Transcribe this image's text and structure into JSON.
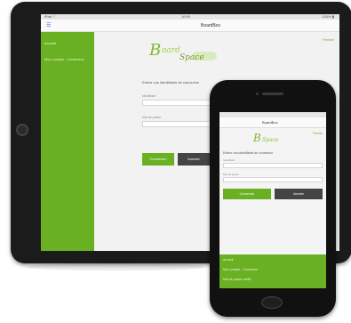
{
  "tablet": {
    "status": {
      "carrier": "iPad ⌔",
      "time": "10:00",
      "battery": "100% ▮"
    },
    "nav": {
      "back_label": "☰",
      "title": "BoardBox"
    },
    "sidebar": {
      "items": [
        "Accueil",
        "Mon compte - Connexion"
      ]
    },
    "logo": {
      "letter": "B",
      "word1": "oard",
      "word2": "Space"
    },
    "right_link": "Fermer",
    "form": {
      "prompt": "Entrez vos identifiants de connexion",
      "login_label": "Identifiant",
      "password_label": "Mot de passe",
      "login_button": "Connexion",
      "cancel_button": "Annuler"
    }
  },
  "phone": {
    "nav": {
      "title": "BoardBox"
    },
    "logo": {
      "letter": "B",
      "word": "Space"
    },
    "right_link": "Fermer",
    "form": {
      "prompt": "Entrez vos identifiants de connexion",
      "login_label": "Identifiant",
      "password_label": "Mot de passe",
      "login_button": "Connexion",
      "cancel_button": "Annuler"
    },
    "bottom_menu": {
      "items": [
        "Accueil",
        "Mon compte - Connexion",
        "Mot de passe oublié"
      ]
    }
  }
}
